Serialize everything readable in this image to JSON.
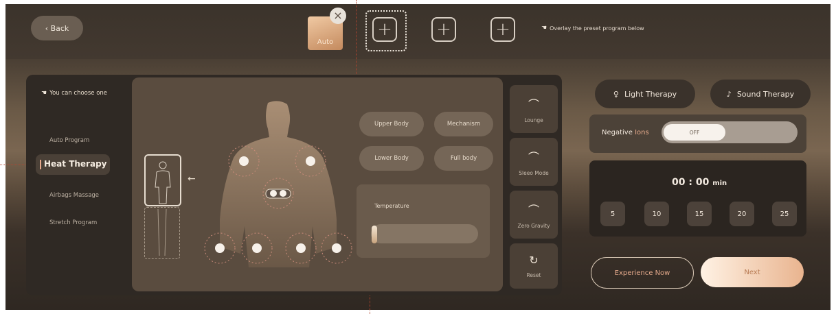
{
  "header": {
    "back_label": "‹ Back",
    "auto_label": "Auto",
    "close_symbol": "×",
    "plus_symbol": "+",
    "hint": "Overlay the preset program below"
  },
  "sidebar": {
    "hint": "You can choose one",
    "items": [
      {
        "label": "Auto Program"
      },
      {
        "label": "Heat Therapy"
      },
      {
        "label": "Airbags Massage"
      },
      {
        "label": "Stretch Program"
      }
    ]
  },
  "zones": [
    {
      "label": "Upper Body"
    },
    {
      "label": "Mechanism"
    },
    {
      "label": "Lower Body"
    },
    {
      "label": "Full body"
    }
  ],
  "temperature": {
    "label": "Temperature",
    "level": 0.0
  },
  "modes": [
    {
      "label": "Lounge",
      "icon": "lounge-icon"
    },
    {
      "label": "Sleeo Mode",
      "icon": "sleep-mode-icon"
    },
    {
      "label": "Zero Gravity",
      "icon": "zero-gravity-icon"
    },
    {
      "label": "Reset",
      "icon": "reset-icon"
    }
  ],
  "therapy": {
    "light_label": "Light Therapy",
    "sound_label": "Sound Therapy"
  },
  "negative_ions": {
    "label_prefix": "Negative",
    "label_accent": "Ions",
    "toggle_label": "OFF"
  },
  "timer": {
    "display": "00 : 00",
    "unit": "min",
    "options": [
      "5",
      "10",
      "15",
      "20",
      "25"
    ]
  },
  "actions": {
    "experience_label": "Experience Now",
    "next_label": "Next"
  },
  "colors": {
    "accent": "#e3a98b",
    "leader_line": "#b3442e"
  }
}
